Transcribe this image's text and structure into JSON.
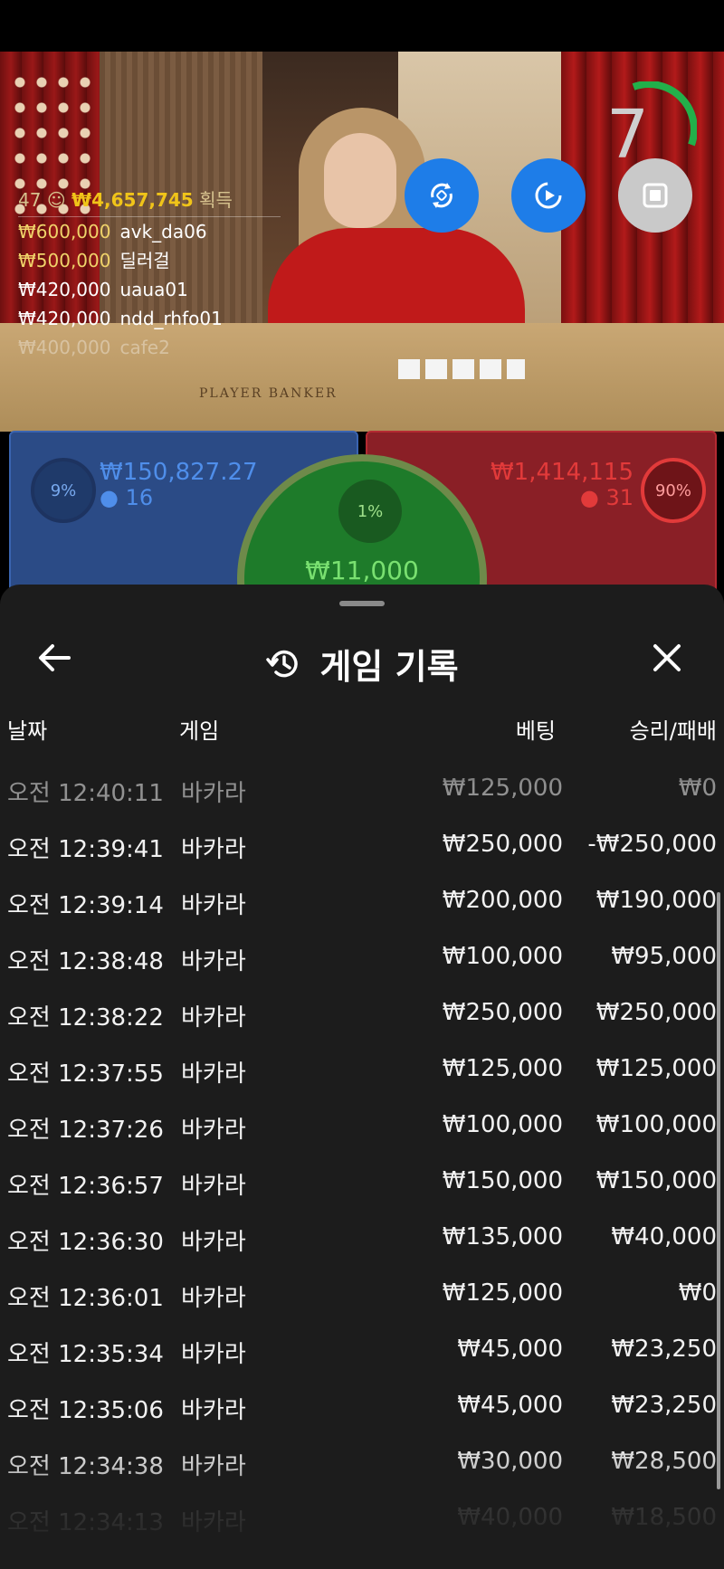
{
  "video": {
    "table_label": "PLAYER    BANKER",
    "timer": "7"
  },
  "winners": {
    "count": "47",
    "total": "₩4,657,745",
    "suffix": "획득",
    "rows": [
      {
        "amount": "₩600,000",
        "name": "avk_da06"
      },
      {
        "amount": "₩500,000",
        "name": "딜러걸"
      },
      {
        "amount": "₩420,000",
        "name": "uaua01"
      },
      {
        "amount": "₩420,000",
        "name": "ndd_rhfo01"
      },
      {
        "amount": "₩400,000",
        "name": "cafe2"
      }
    ]
  },
  "bets": {
    "player": {
      "percent": "9%",
      "amount": "₩150,827.27",
      "count": "16"
    },
    "banker": {
      "percent": "90%",
      "amount": "₩1,414,115",
      "count": "31"
    },
    "tie": {
      "percent": "1%",
      "amount": "₩11,000"
    }
  },
  "sheet": {
    "title": "게임 기록",
    "columns": {
      "date": "날짜",
      "game": "게임",
      "bet": "베팅",
      "winloss": "승리/패배"
    },
    "rows": [
      {
        "time": "오전 12:40:11",
        "game": "바카라",
        "bet": "₩125,000",
        "result": "₩0"
      },
      {
        "time": "오전 12:39:41",
        "game": "바카라",
        "bet": "₩250,000",
        "result": "-₩250,000"
      },
      {
        "time": "오전 12:39:14",
        "game": "바카라",
        "bet": "₩200,000",
        "result": "₩190,000"
      },
      {
        "time": "오전 12:38:48",
        "game": "바카라",
        "bet": "₩100,000",
        "result": "₩95,000"
      },
      {
        "time": "오전 12:38:22",
        "game": "바카라",
        "bet": "₩250,000",
        "result": "₩250,000"
      },
      {
        "time": "오전 12:37:55",
        "game": "바카라",
        "bet": "₩125,000",
        "result": "₩125,000"
      },
      {
        "time": "오전 12:37:26",
        "game": "바카라",
        "bet": "₩100,000",
        "result": "₩100,000"
      },
      {
        "time": "오전 12:36:57",
        "game": "바카라",
        "bet": "₩150,000",
        "result": "₩150,000"
      },
      {
        "time": "오전 12:36:30",
        "game": "바카라",
        "bet": "₩135,000",
        "result": "₩40,000"
      },
      {
        "time": "오전 12:36:01",
        "game": "바카라",
        "bet": "₩125,000",
        "result": "₩0"
      },
      {
        "time": "오전 12:35:34",
        "game": "바카라",
        "bet": "₩45,000",
        "result": "₩23,250"
      },
      {
        "time": "오전 12:35:06",
        "game": "바카라",
        "bet": "₩45,000",
        "result": "₩23,250"
      },
      {
        "time": "오전 12:34:38",
        "game": "바카라",
        "bet": "₩30,000",
        "result": "₩28,500"
      },
      {
        "time": "오전 12:34:13",
        "game": "바카라",
        "bet": "₩40,000",
        "result": "₩18,500"
      }
    ]
  }
}
